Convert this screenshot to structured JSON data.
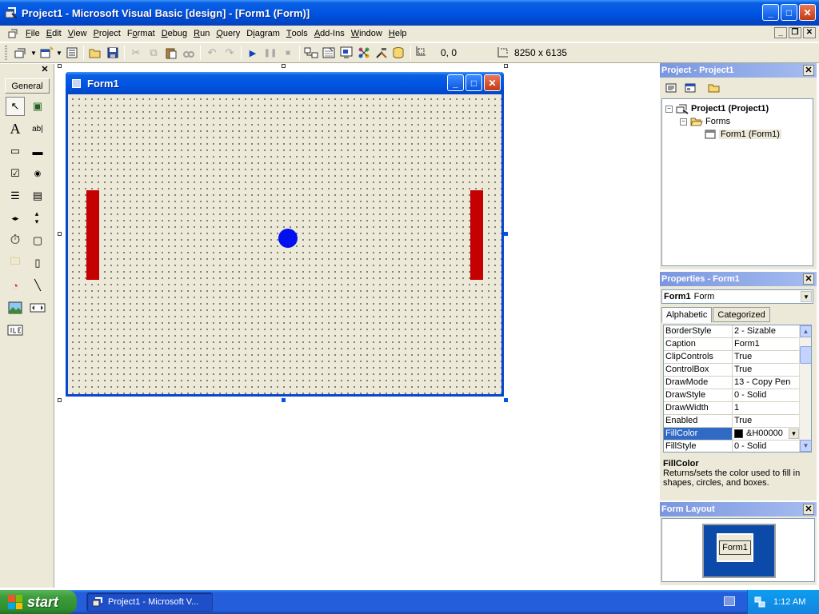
{
  "title_bar": {
    "title": "Project1 - Microsoft Visual Basic [design] - [Form1 (Form)]",
    "minimize": "_",
    "maximize": "□",
    "close": "✕"
  },
  "menubar": {
    "items": [
      {
        "label": "File"
      },
      {
        "label": "Edit"
      },
      {
        "label": "View"
      },
      {
        "label": "Project"
      },
      {
        "label": "Format"
      },
      {
        "label": "Debug"
      },
      {
        "label": "Run"
      },
      {
        "label": "Query"
      },
      {
        "label": "Diagram"
      },
      {
        "label": "Tools"
      },
      {
        "label": "Add-Ins"
      },
      {
        "label": "Window"
      },
      {
        "label": "Help"
      }
    ],
    "mdi_minimize": "_",
    "mdi_restore": "❐",
    "mdi_close": "✕"
  },
  "toolbar": {
    "position_readout": "0, 0",
    "size_readout": "8250 x 6135"
  },
  "toolbox": {
    "tab_label": "General",
    "close": "✕",
    "tools": [
      "↖",
      "▣",
      "A",
      "ab|",
      "▭",
      "▬",
      "☑",
      "◉",
      "☰",
      "▤",
      "◂▸",
      "▴▾",
      "⏱",
      "▢",
      "🗀",
      "▯",
      "◔",
      "╲"
    ]
  },
  "form_designer": {
    "window_title": "Form1",
    "minimize": "_",
    "maximize": "□",
    "close": "✕",
    "colors": {
      "paddle": "#c40000",
      "ball": "#0010f0",
      "canvas": "#ece9d8"
    }
  },
  "project_panel": {
    "title": "Project - Project1",
    "close": "✕",
    "tree": {
      "root": "Project1 (Project1)",
      "folder": "Forms",
      "item": "Form1 (Form1)"
    }
  },
  "properties_panel": {
    "title": "Properties - Form1",
    "close": "✕",
    "object_name": "Form1",
    "object_type": "Form",
    "tabs": [
      "Alphabetic",
      "Categorized"
    ],
    "rows": [
      {
        "name": "BorderStyle",
        "value": "2 - Sizable"
      },
      {
        "name": "Caption",
        "value": "Form1"
      },
      {
        "name": "ClipControls",
        "value": "True"
      },
      {
        "name": "ControlBox",
        "value": "True"
      },
      {
        "name": "DrawMode",
        "value": "13 - Copy Pen"
      },
      {
        "name": "DrawStyle",
        "value": "0 - Solid"
      },
      {
        "name": "DrawWidth",
        "value": "1"
      },
      {
        "name": "Enabled",
        "value": "True"
      },
      {
        "name": "FillColor",
        "value": "&H00000"
      },
      {
        "name": "FillStyle",
        "value": "0 - Solid"
      }
    ],
    "description_title": "FillColor",
    "description_text": "Returns/sets the color used to fill in shapes, circles, and boxes."
  },
  "form_layout_panel": {
    "title": "Form Layout",
    "close": "✕",
    "form_label": "Form1"
  },
  "taskbar": {
    "start_label": "start",
    "task_label": "Project1 - Microsoft V...",
    "clock": "1:12 AM"
  }
}
